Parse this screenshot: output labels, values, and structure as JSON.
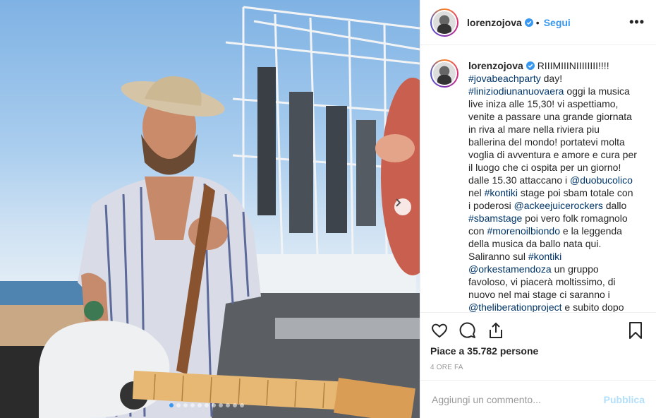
{
  "post": {
    "username": "lorenzojova",
    "follow_label": "Segui",
    "separator": "•",
    "more_label": "•••"
  },
  "caption": {
    "username": "lorenzojova",
    "segments": [
      {
        "text": "RIIIMIIINIIIIIIII!!!! ",
        "tag": false
      },
      {
        "text": "#jovabeachparty",
        "tag": true
      },
      {
        "text": " day! ",
        "tag": false
      },
      {
        "text": "#liniziodiunanuovaera",
        "tag": true
      },
      {
        "text": " oggi la musica live iniza alle 15,30! vi aspettiamo, venite a passare una grande giornata in riva al mare nella riviera piu ballerina del mondo! portatevi molta voglia di avventura e amore e cura per il luogo che ci ospita per un giorno! dalle 15.30 attaccano i ",
        "tag": false
      },
      {
        "text": "@duobucolico",
        "tag": true
      },
      {
        "text": " nel ",
        "tag": false
      },
      {
        "text": "#kontiki",
        "tag": true
      },
      {
        "text": " stage poi sbam totale con i poderosi ",
        "tag": false
      },
      {
        "text": "@ackeejuicerockers",
        "tag": true
      },
      {
        "text": " dallo ",
        "tag": false
      },
      {
        "text": "#sbamstage",
        "tag": true
      },
      {
        "text": " poi vero folk romagnolo con ",
        "tag": false
      },
      {
        "text": "#morenoilbiondo",
        "tag": true
      },
      {
        "text": " e la leggenda della musica da ballo nata qui. Saliranno sul ",
        "tag": false
      },
      {
        "text": "#kontiki",
        "tag": true
      },
      {
        "text": " ",
        "tag": false
      },
      {
        "text": "@orkestamendoza",
        "tag": true
      },
      {
        "text": " un gruppo favoloso, vi piacerà moltissimo, di nuovo nel mai stage ci saranno i ",
        "tag": false
      },
      {
        "text": "@theliberationproject",
        "tag": true
      },
      {
        "text": " e subito dopo",
        "tag": false
      }
    ]
  },
  "likes": {
    "text": "Piace a 35.782 persone"
  },
  "timestamp": "4 ORE FA",
  "comment_box": {
    "placeholder": "Aggiungi un commento...",
    "publish_label": "Pubblica"
  },
  "carousel": {
    "dot_count": 11,
    "active_index": 0
  },
  "icons": {
    "like": "heart-icon",
    "comment": "comment-bubble-icon",
    "share": "share-icon",
    "save": "bookmark-icon",
    "verified": "verified-badge-icon",
    "next": "chevron-right-icon"
  },
  "colors": {
    "link_blue": "#3897f0",
    "tag_blue": "#003569",
    "verified_blue": "#3897f0",
    "publish_disabled": "#b2dffc"
  }
}
